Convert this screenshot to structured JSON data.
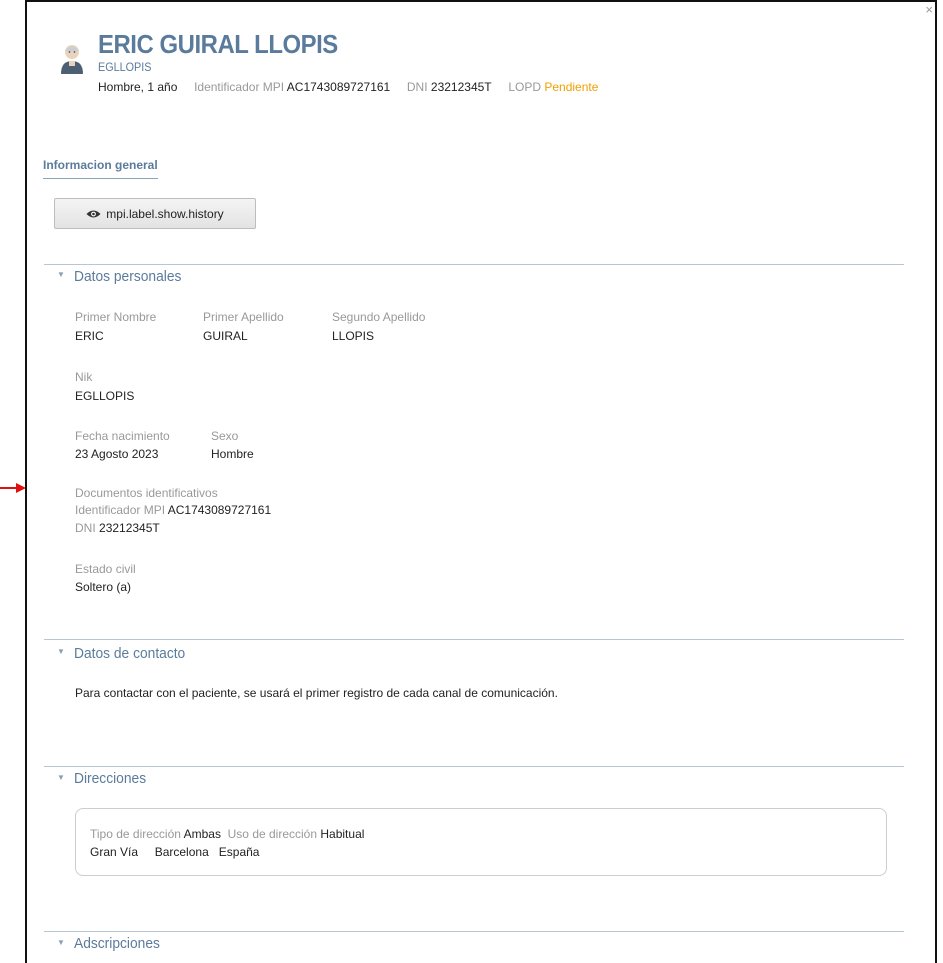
{
  "header": {
    "name": "ERIC GUIRAL LLOPIS",
    "nik": "EGLLOPIS",
    "gender_age": "Hombre, 1 año",
    "mpi_label": "Identificador MPI",
    "mpi_value": "AC1743089727161",
    "dni_label": "DNI",
    "dni_value": "23212345T",
    "lopd_label": "LOPD",
    "lopd_value": "Pendiente"
  },
  "close_icon": "×",
  "tabs": {
    "general": "Informacion general"
  },
  "history_button": {
    "label": "mpi.label.show.history",
    "icon": "eye-icon"
  },
  "personal": {
    "title": "Datos personales",
    "first_name_label": "Primer Nombre",
    "first_name": "ERIC",
    "surname1_label": "Primer Apellido",
    "surname1": "GUIRAL",
    "surname2_label": "Segundo Apellido",
    "surname2": "LLOPIS",
    "nik_label": "Nik",
    "nik": "EGLLOPIS",
    "birth_label": "Fecha nacimiento",
    "birth": "23 Agosto 2023",
    "sex_label": "Sexo",
    "sex": "Hombre",
    "docs_label": "Documentos identificativos",
    "mpi_label": "Identificador MPI",
    "mpi_value": "AC1743089727161",
    "dni_label": "DNI",
    "dni_value": "23212345T",
    "civil_label": "Estado civil",
    "civil": "Soltero (a)"
  },
  "contact": {
    "title": "Datos de contacto",
    "note": "Para contactar con el paciente, se usará el primer registro de cada canal de comunicación."
  },
  "addresses": {
    "title": "Direcciones",
    "type_label": "Tipo de dirección",
    "type": "Ambas",
    "use_label": "Uso de dirección",
    "use": "Habitual",
    "street": "Gran Vía",
    "city": "Barcelona",
    "country": "España"
  },
  "adscriptions": {
    "title": "Adscripciones"
  },
  "colors": {
    "accent": "#5b7b9c",
    "warning": "#f0a000",
    "arrow": "#e01010"
  }
}
